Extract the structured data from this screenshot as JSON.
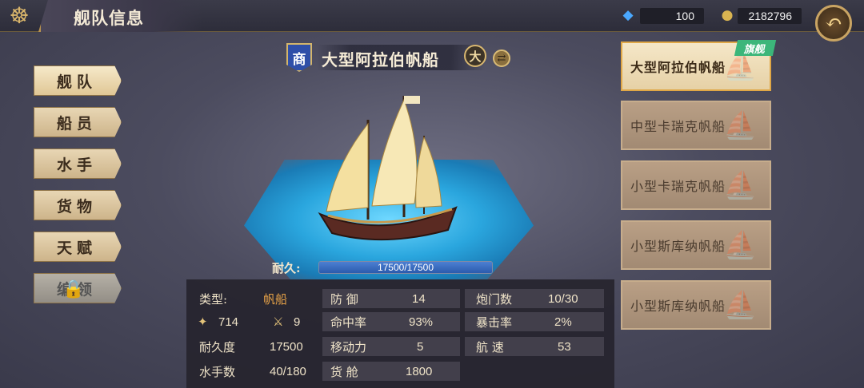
{
  "header": {
    "title": "舰队信息",
    "helm_icon": "ship-wheel-icon"
  },
  "resources": {
    "gems": "100",
    "coins": "2182796"
  },
  "nav": {
    "items": [
      {
        "label": "舰队",
        "active": true
      },
      {
        "label": "船员"
      },
      {
        "label": "水手"
      },
      {
        "label": "货物"
      },
      {
        "label": "天赋"
      },
      {
        "label": "编领",
        "locked": true
      }
    ]
  },
  "ship": {
    "type_badge": "商",
    "name": "大型阿拉伯帆船",
    "size_badge": "大",
    "durability_label": "耐久:",
    "durability_text": "17500/17500",
    "durability_fraction": 1.0
  },
  "stats": {
    "type_label": "类型:",
    "type_value": "帆船",
    "icon1_value": "714",
    "icon2_value": "9",
    "durability_label": "耐久度",
    "durability_value": "17500",
    "sailors_label": "水手数",
    "sailors_value": "40/180",
    "defense_label": "防 御",
    "defense_value": "14",
    "hit_label": "命中率",
    "hit_value": "93%",
    "move_label": "移动力",
    "move_value": "5",
    "cargo_label": "货 舱",
    "cargo_value": "1800",
    "cannon_label": "炮门数",
    "cannon_value": "10/30",
    "crit_label": "暴击率",
    "crit_value": "2%",
    "speed_label": "航 速",
    "speed_value": "53"
  },
  "fleet": {
    "flag_tag": "旗舰",
    "ships": [
      {
        "name": "大型阿拉伯帆船",
        "active": true
      },
      {
        "name": "中型卡瑞克帆船"
      },
      {
        "name": "小型卡瑞克帆船"
      },
      {
        "name": "小型斯库纳帆船"
      },
      {
        "name": "小型斯库纳帆船"
      }
    ]
  },
  "colors": {
    "accent_gold": "#d8b46a",
    "durability_blue": "#2b5bad",
    "flag_green": "#3cb67a"
  }
}
